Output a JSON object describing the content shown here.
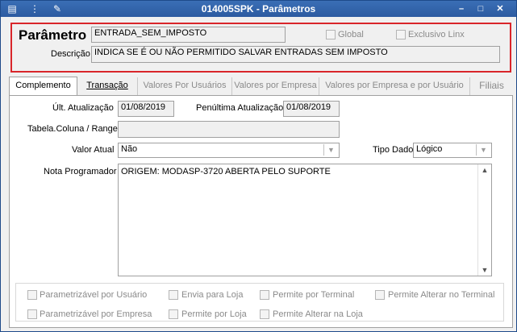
{
  "window": {
    "title": "014005SPK - Parâmetros"
  },
  "header": {
    "param_label": "Parâmetro",
    "param_value": "ENTRADA_SEM_IMPOSTO",
    "global_label": "Global",
    "exclusivo_label": "Exclusivo Linx",
    "desc_label": "Descrição",
    "desc_value": "INDICA SE É OU NÃO PERMITIDO SALVAR ENTRADAS SEM IMPOSTO"
  },
  "tabs": [
    {
      "label": "Complemento"
    },
    {
      "label": "Transação"
    },
    {
      "label": "Valores Por Usuários"
    },
    {
      "label": "Valores por Empresa"
    },
    {
      "label": "Valores por Empresa e por Usuário"
    },
    {
      "label": "Filiais"
    }
  ],
  "form": {
    "ult_label": "Últ. Atualização",
    "ult_value": "01/08/2019",
    "pen_label": "Penúltima Atualização",
    "pen_value": "01/08/2019",
    "tabela_label": "Tabela.Coluna / Range",
    "tabela_value": "",
    "valor_label": "Valor Atual",
    "valor_value": "Não",
    "tipo_label": "Tipo Dado",
    "tipo_value": "Lógico",
    "nota_label": "Nota Programador",
    "nota_value": "ORIGEM: MODASP-3720 ABERTA PELO SUPORTE"
  },
  "checkboxes": {
    "parm_usuario": "Parametrizável por Usuário",
    "envia_loja": "Envia para Loja",
    "permite_terminal": "Permite por Terminal",
    "permite_alterar_terminal": "Permite Alterar no Terminal",
    "parm_empresa": "Parametrizável por Empresa",
    "permite_loja": "Permite por Loja",
    "permite_alterar_loja": "Permite Alterar na Loja"
  }
}
